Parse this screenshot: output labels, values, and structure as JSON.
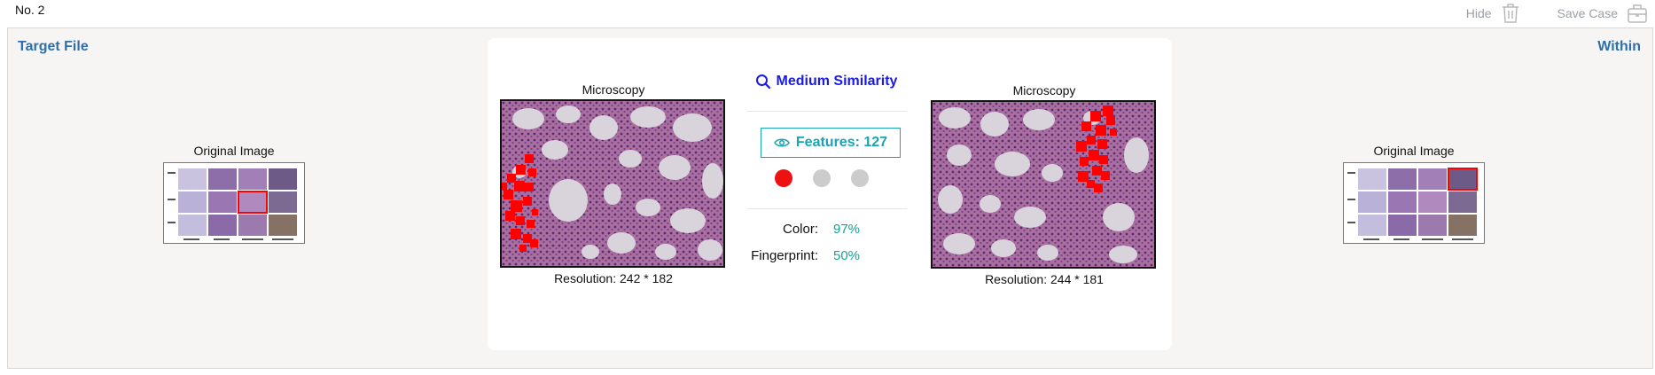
{
  "header": {
    "case_no": "No. 2",
    "hide_label": "Hide",
    "save_case_label": "Save Case",
    "icons": {
      "hide": "trash-icon",
      "save": "briefcase-icon"
    }
  },
  "panel": {
    "left_title": "Target File",
    "right_title": "Within"
  },
  "left_original": {
    "caption": "Original Image"
  },
  "right_original": {
    "caption": "Original Image"
  },
  "comparison": {
    "left": {
      "caption": "Microscopy",
      "resolution": "Resolution: 242 * 182"
    },
    "right": {
      "caption": "Microscopy",
      "resolution": "Resolution: 244 * 181"
    },
    "similarity": {
      "label": "Medium Similarity",
      "icon": "search-icon",
      "color": "#1a1ae6"
    },
    "features": {
      "label": "Features: 127",
      "icon": "eye-icon",
      "color": "#1aa3b3"
    },
    "dots": [
      {
        "state": "active",
        "color": "#ee1111"
      },
      {
        "state": "inactive",
        "color": "#cccccc"
      },
      {
        "state": "inactive",
        "color": "#cccccc"
      }
    ],
    "metrics": [
      {
        "key": "Color:",
        "value": "97%"
      },
      {
        "key": "Fingerprint:",
        "value": "50%"
      }
    ]
  },
  "colors": {
    "title_blue": "#2f6fa8",
    "value_teal": "#13a39a",
    "match_red": "#ff0000",
    "tissue_pink": "#b07ab4"
  }
}
